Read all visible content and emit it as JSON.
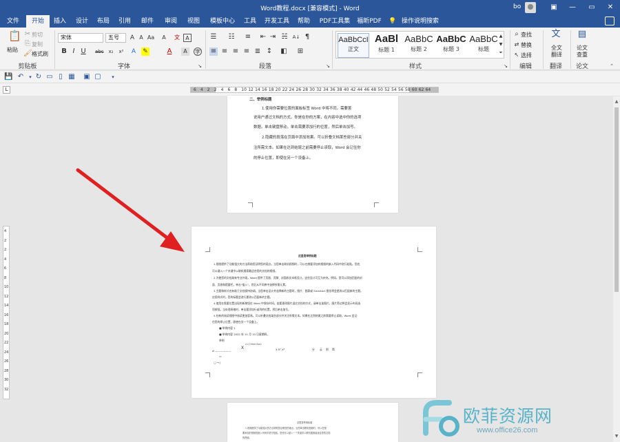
{
  "titlebar": {
    "title": "Word教程.docx [兼容模式] - Word",
    "user": "bo",
    "minimize": "—",
    "restore": "▭",
    "close": "✕"
  },
  "menu": {
    "tabs": [
      "文件",
      "开始",
      "插入",
      "设计",
      "布局",
      "引用",
      "邮件",
      "审阅",
      "视图",
      "模板中心",
      "工具",
      "开发工具",
      "帮助",
      "PDF工具集",
      "福昕PDF"
    ],
    "active": "开始",
    "tell_me": "操作说明搜索"
  },
  "ribbon": {
    "clipboard": {
      "label": "剪贴板",
      "paste": "粘贴",
      "cut": "剪切",
      "copy": "复制",
      "format_painter": "格式刷"
    },
    "font": {
      "label": "字体",
      "font_name": "宋体",
      "font_size": "五号",
      "wen": "文",
      "a_font": "A"
    },
    "paragraph": {
      "label": "段落"
    },
    "styles": {
      "label": "样式",
      "items": [
        {
          "sample": "AaBbCcI",
          "name": "正文"
        },
        {
          "sample": "AaBl",
          "name": "标题 1"
        },
        {
          "sample": "AaBbC",
          "name": "标题 2"
        },
        {
          "sample": "AaBbC",
          "name": "标题 3"
        },
        {
          "sample": "AaBbC",
          "name": "标题"
        }
      ]
    },
    "editing": {
      "label": "编辑",
      "find": "查找",
      "replace": "替换",
      "select": "选择"
    },
    "translate": {
      "label": "翻译",
      "full_translate": "全文翻译"
    },
    "paper": {
      "label": "论文",
      "paper_check": "论文查重"
    }
  },
  "ruler": {
    "numbers": [
      "6",
      "4",
      "2",
      "2",
      "4",
      "6",
      "8",
      "10",
      "12",
      "14",
      "16",
      "18",
      "20",
      "22",
      "24",
      "26",
      "28",
      "30",
      "32",
      "34",
      "36",
      "38",
      "40",
      "42",
      "44",
      "46",
      "48",
      "50",
      "52",
      "54",
      "56",
      "58",
      "60",
      "62",
      "64"
    ],
    "vnumbers": [
      "4",
      "2",
      "2",
      "4",
      "6",
      "8",
      "10",
      "12",
      "14",
      "16",
      "18",
      "20",
      "22",
      "24",
      "26",
      "28",
      "30",
      "32"
    ]
  },
  "page1": {
    "heading": "二、举例标题",
    "lines": [
      "1.使用你需要位置的面板标签 Word 中将不同。需要置",
      "说用户通过文档的方式，你是在你的方案，在内容中选中你的选项",
      "数据。单击键盘移动，单击需要添加行的位置，然后单击加号。",
      "2.隐藏的段落在页面中添加效果。可以折叠文档某些部分并关",
      "注所需文本。如果在达到结尾之前需要停止读取，Word 会记住你",
      "的停止位置，即使在另一个设备上。"
    ]
  },
  "page2": {
    "title": "这里是举例标题",
    "lines": [
      "1.视频提供了功能强大的方法帮助您证明您的观点。当您单击联机视频时，可以在想要添加的视频的嵌入代码中进行粘贴。您也",
      "可以键入一个关键字以联机搜索最适合您的文档的视频。",
      "2.为使您的文档具有专业外观，Word 提供了页眉、页脚、封面和文本框设计，这些设计可互为补充。例如，您可以添加匹配的封",
      "面、页眉和提要栏。单击\"插入\"，然后从不同库中选择所需元素。",
      "3.主题和样式也有助于文档保持协调。当您单击设计并选择新的主题时，图片、图表或 SmartArt 图形将会更改以匹配新的主题。",
      "应用样式时，您的标题会进行更改以匹配新的主题。",
      "4.使用在需要位置出现的新按钮在 Word 中保存时间。若要更改图片适应文档的方式，请单击该图片，图片旁边将会显示布局选",
      "项按钮。当处理表格时，单击要添加行或列的位置，然后单击加号。",
      "5.在新的阅读视图中阅读更加容易。可以折叠文档某些部分并关注所需文本。如果在达到结尾之前需要停止读取，Word 会记",
      "住您的停止位置，即使在另一个设备上。",
      "■  举例内容 1",
      "■  举例内容 2022 年 11 月 10 日星期四。",
      "举例",
      "X  X²  X³"
    ],
    "field_code": "z=(Check Box)",
    "sub_chars": [
      "X¹",
      "分",
      "X⁰",
      "云",
      "刻",
      "简",
      "图"
    ]
  },
  "page3": {
    "title": "这里是举例标题",
    "lines": [
      "1.视频提供了功能强大的方法帮助您证明您的观点。当您单击联机视频时，可以在想",
      "要添加的视频的嵌入代码中进行粘贴。您也可以键入一个关键字以联机搜索最适合您的文档",
      "的视频。"
    ]
  },
  "watermark": {
    "text": "欧菲资源网",
    "url": "www.office26.com"
  },
  "colors": {
    "word_blue": "#2b579a",
    "arrow_red": "#e02020",
    "watermark": "#58b3c8"
  }
}
